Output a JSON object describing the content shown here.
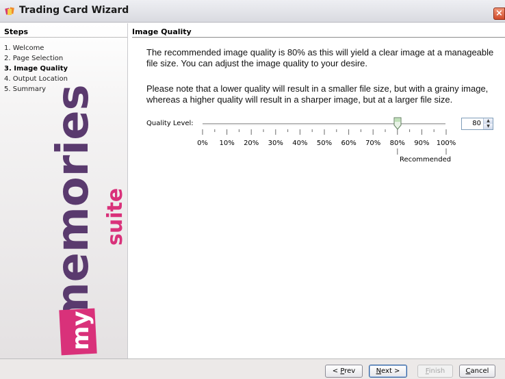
{
  "window": {
    "title": "Trading Card Wizard",
    "close_glyph": "×"
  },
  "sidebar": {
    "header": "Steps",
    "steps": [
      "1. Welcome",
      "2. Page Selection",
      "3. Image Quality",
      "4. Output Location",
      "5. Summary"
    ],
    "current_step_index": 2,
    "logo": {
      "my": "my",
      "memories": "memories",
      "suite": "suite"
    }
  },
  "main": {
    "header": "Image Quality",
    "paragraph1": "The recommended image quality is 80% as this will yield a clear image at a manageable file size. You can adjust the image quality to your desire.",
    "paragraph2": "Please note that a lower quality will result in a smaller file size, but with a grainy image, whereas a higher quality will result in a sharper image, but at a larger file size.",
    "quality": {
      "label": "Quality Level:",
      "value": 80,
      "value_text": "80",
      "min": 0,
      "max": 100,
      "tick_labels": [
        "0%",
        "10%",
        "20%",
        "30%",
        "40%",
        "50%",
        "60%",
        "70%",
        "80%",
        "90%",
        "100%"
      ],
      "recommended_label": "Recommended",
      "recommended_value": 80
    }
  },
  "footer": {
    "prev": {
      "pre": "< ",
      "key": "P",
      "rest": "rev"
    },
    "next": {
      "key": "N",
      "rest": "ext >"
    },
    "finish": {
      "key": "F",
      "rest": "inish"
    },
    "cancel": {
      "key": "C",
      "rest": "ancel"
    }
  },
  "colors": {
    "logo_purple": "#5a3a6e",
    "logo_pink": "#d9317a",
    "title_bg": "#dcdde3",
    "close_red": "#d04a2a"
  }
}
